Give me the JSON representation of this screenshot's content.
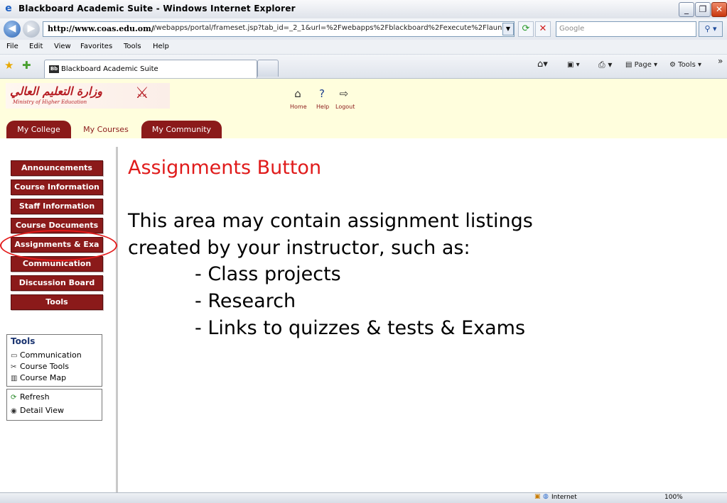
{
  "window": {
    "title": "Blackboard Academic Suite - Windows Internet Explorer",
    "minimize_glyph": "_",
    "maximize_glyph": "❐",
    "close_glyph": "✕"
  },
  "address_bar": {
    "url_host": "http://www.coas.edu.om/",
    "url_path": "./webapps/portal/frameset.jsp?tab_id=_2_1&url=%2Fwebapps%2Fblackboard%2Fexecute%2Flaunc",
    "search_placeholder": "Google"
  },
  "menu": {
    "items": [
      "File",
      "Edit",
      "View",
      "Favorites",
      "Tools",
      "Help"
    ]
  },
  "browser_tab": {
    "favicon": "Bb",
    "label": "Blackboard Academic Suite"
  },
  "command_bar": {
    "page_label": "Page",
    "tools_label": "Tools",
    "overflow": "»"
  },
  "header": {
    "logo_arabic": "وزارة التعليم العالي",
    "logo_english": "Ministry of Higher Education",
    "top_links": [
      "Home",
      "Help",
      "Logout"
    ],
    "tabs": [
      {
        "label": "My College",
        "active": false
      },
      {
        "label": "My Courses",
        "active": true
      },
      {
        "label": "My Community",
        "active": false
      }
    ]
  },
  "course_menu": {
    "buttons": [
      "Announcements",
      "Course Information",
      "Staff Information",
      "Course Documents",
      "Assignments & Exa",
      "Communication",
      "Discussion Board",
      "Tools"
    ],
    "highlighted": "Assignments & Exa"
  },
  "tools_panel": {
    "title": "Tools",
    "items": [
      {
        "icon": "computer-icon",
        "label": "Communication"
      },
      {
        "icon": "wrench-icon",
        "label": "Course Tools"
      },
      {
        "icon": "map-icon",
        "label": "Course Map"
      }
    ]
  },
  "action_panel": {
    "items": [
      {
        "icon": "refresh-icon",
        "label": "Refresh"
      },
      {
        "icon": "detail-view-icon",
        "label": "Detail View"
      }
    ]
  },
  "content": {
    "title": "Assignments Button",
    "line1": "This area may contain assignment listings",
    "line2": "created by your instructor, such as:",
    "bullets": [
      "- Class projects",
      "- Research",
      "- Links to quizzes & tests & Exams"
    ]
  },
  "status_bar": {
    "zone": "Internet",
    "zoom": "100%"
  },
  "colors": {
    "brand_red": "#8b1a1a",
    "title_red": "#e01b1b",
    "header_bg": "#fffedd",
    "highlight_oval": "#e31b1b"
  }
}
